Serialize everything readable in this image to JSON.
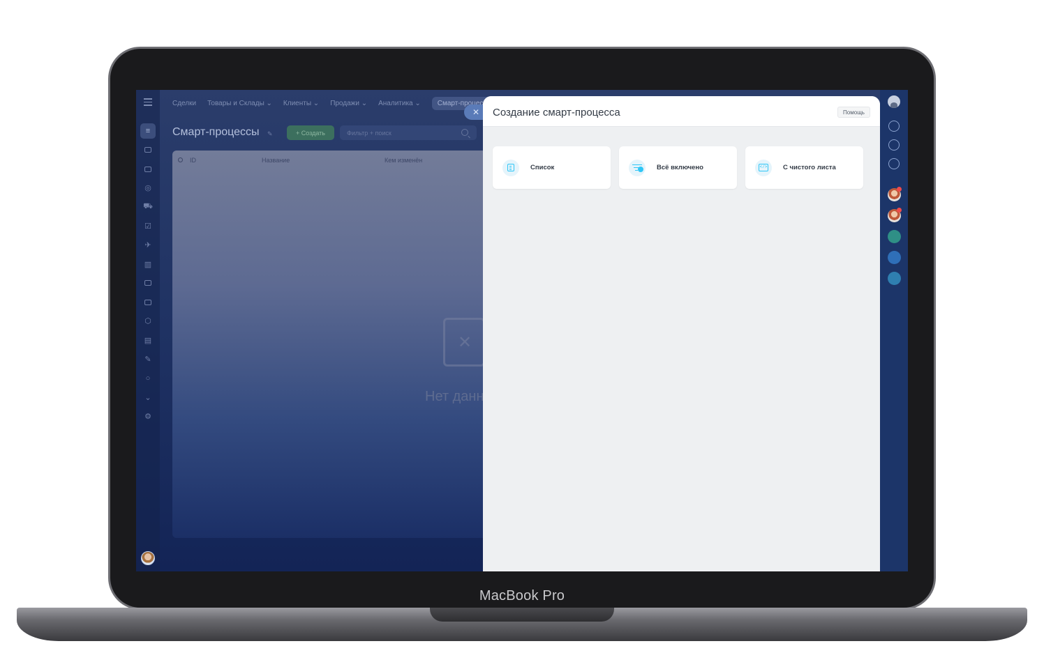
{
  "device": {
    "label": "MacBook Pro"
  },
  "topnav": {
    "items": [
      {
        "label": "Сделки"
      },
      {
        "label": "Товары и Склады ⌄"
      },
      {
        "label": "Клиенты ⌄"
      },
      {
        "label": "Продажи ⌄"
      },
      {
        "label": "Аналитика ⌄"
      },
      {
        "label": "Смарт-процессы"
      }
    ]
  },
  "page": {
    "title": "Смарт-процессы",
    "create_label": "+ Создать",
    "filter_placeholder": "Фильтр + поиск"
  },
  "grid": {
    "columns": [
      "ID",
      "Название",
      "Кем изменён"
    ],
    "empty_text": "Нет данных"
  },
  "slider": {
    "close_label": "✕",
    "title": "Создание смарт-процесса",
    "help_label": "Помощь",
    "cards": [
      {
        "label": "Список",
        "icon": "list-icon"
      },
      {
        "label": "Всё включено",
        "icon": "filter-check-icon"
      },
      {
        "label": "С чистого листа",
        "icon": "code-icon"
      }
    ]
  },
  "colors": {
    "accent": "#2fc6f6",
    "create_button": "#3c6f5e",
    "screen_bg": "#1f3263",
    "slider_bg": "#eef0f2"
  }
}
